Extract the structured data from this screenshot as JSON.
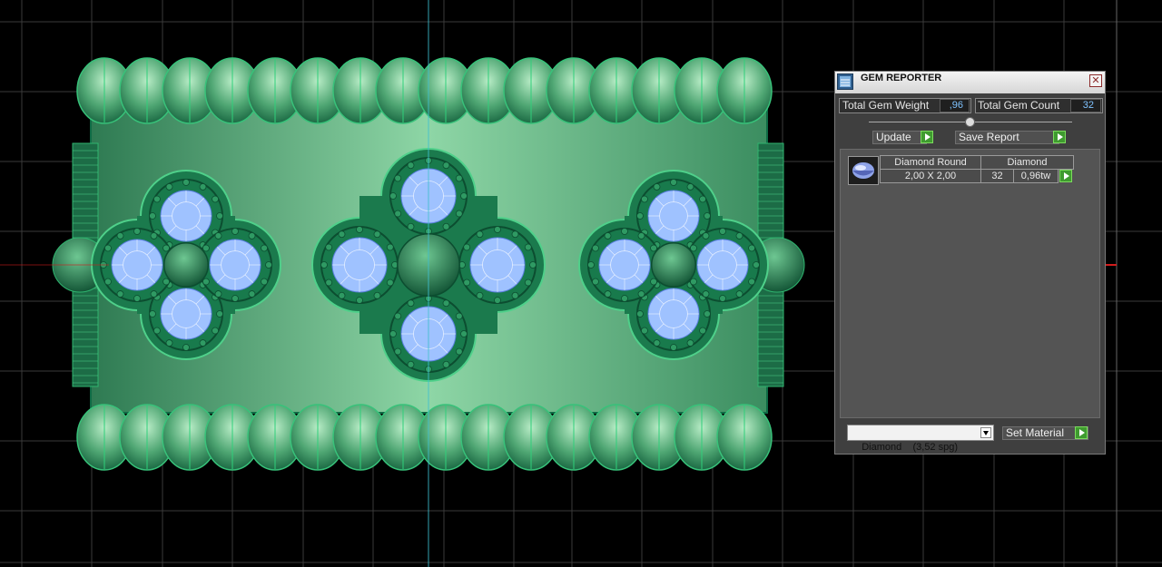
{
  "gem_reporter": {
    "title": "GEM REPORTER",
    "close_label": "✕",
    "total_gem_weight_label": "Total Gem Weight",
    "total_gem_weight_value": ",96",
    "total_gem_count_label": "Total Gem Count",
    "total_gem_count_value": "32",
    "update_label": "Update",
    "save_report_label": "Save Report",
    "table": {
      "col1_header": "Diamond Round",
      "col2_header": "Diamond",
      "rows": [
        {
          "size": "2,00 X 2,00",
          "count": "32",
          "weight": "0,96tw"
        }
      ]
    },
    "material_select": "Diamond    (3,52 spg)",
    "set_material_label": "Set Material"
  },
  "colors": {
    "viewport_background": "#000000",
    "grid": "#3a3a3a",
    "band": "#5fb585",
    "band_edge": "#0f6b45",
    "bezel": "#1f7a50",
    "gem": "#9fc2ff",
    "axis_red": "#d01c1c",
    "axis_cyan": "#3fbfd0",
    "panel": "#3f3f3f",
    "value_text": "#7fc3ff",
    "play_button": "#3f9b2f"
  }
}
